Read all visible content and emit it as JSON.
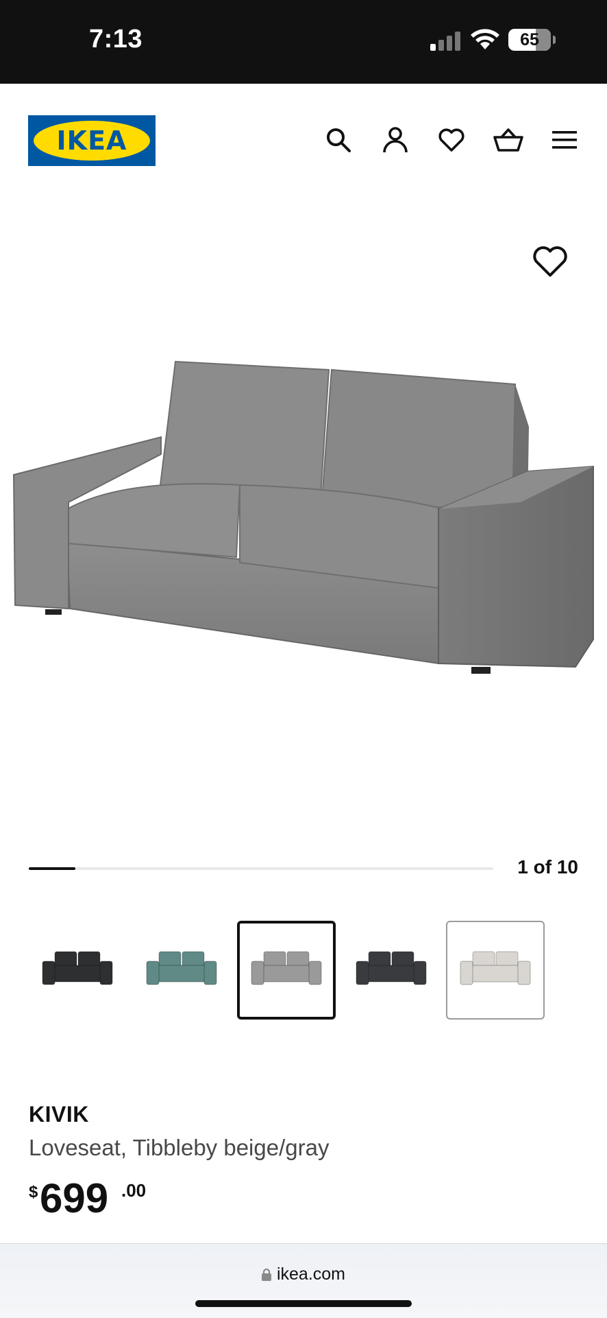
{
  "status_bar": {
    "time": "7:13",
    "battery_level": "65",
    "battery_fraction": 0.65
  },
  "header": {
    "logo_text": "IKEA",
    "icons": [
      "search-icon",
      "account-icon",
      "heart-icon",
      "basket-icon",
      "menu-icon"
    ]
  },
  "gallery": {
    "favorite_icon": "heart-icon",
    "counter": "1 of 10",
    "progress_fraction": 0.1
  },
  "variants": [
    {
      "color": "#2e2f31",
      "selected": false
    },
    {
      "color": "#5f8a86",
      "selected": false
    },
    {
      "color": "#9a9a9a",
      "selected": true
    },
    {
      "color": "#3a3b3e",
      "selected": false
    },
    {
      "color": "#d9d6d1",
      "selected": false,
      "outlined": true
    }
  ],
  "product": {
    "name": "KIVIK",
    "description": "Loveseat, Tibbleby beige/gray",
    "price_currency": "$",
    "price_integer": "699",
    "price_decimal": ".00"
  },
  "browser": {
    "url": "ikea.com",
    "lock_icon": "lock-icon"
  },
  "colors": {
    "brand_blue": "#0058a3",
    "brand_yellow": "#ffdb00",
    "text": "#111111"
  }
}
